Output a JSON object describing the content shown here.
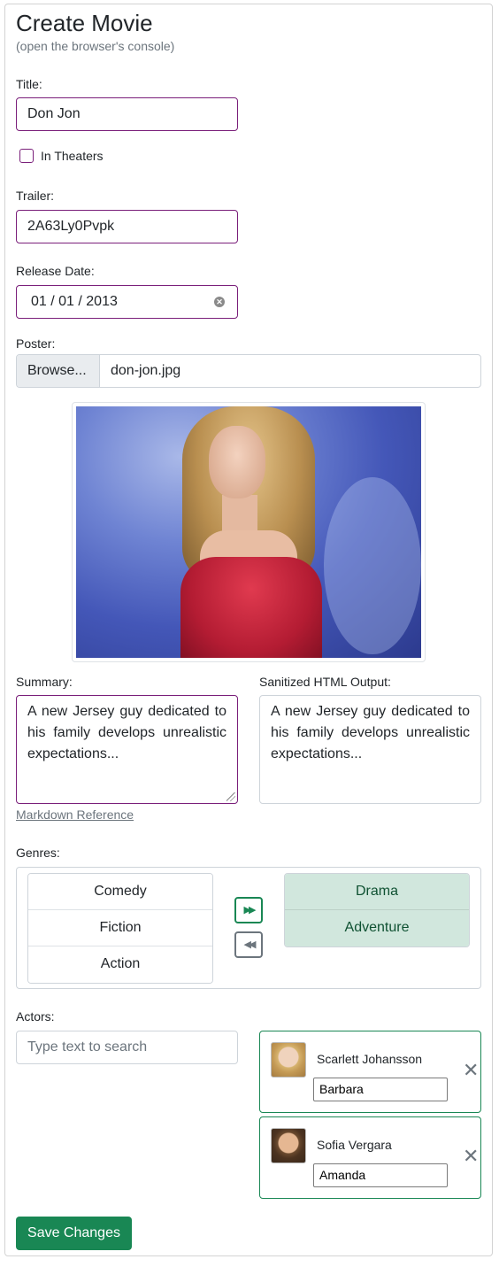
{
  "header": {
    "title": "Create Movie",
    "subtitle": "(open the browser's console)"
  },
  "form": {
    "title_label": "Title:",
    "title_value": "Don Jon",
    "in_theaters_label": "In Theaters",
    "in_theaters_checked": false,
    "trailer_label": "Trailer:",
    "trailer_value": "2A63Ly0Pvpk",
    "release_date_label": "Release Date:",
    "release_date_value": "01 / 01 / 2013",
    "poster_label": "Poster:",
    "browse_label": "Browse...",
    "poster_file": "don-jon.jpg",
    "summary_label": "Summary:",
    "summary_value": "A new Jersey guy dedicated to his family develops unrealistic expectations...",
    "sanitized_label": "Sanitized HTML Output:",
    "sanitized_value": "A new Jersey guy dedicated to his family develops unrealistic expectations...",
    "markdown_link": "Markdown Reference",
    "genres_label": "Genres:",
    "genres_available": [
      "Comedy",
      "Fiction",
      "Action"
    ],
    "genres_selected": [
      "Drama",
      "Adventure"
    ],
    "move_right_icon": "double-right-arrow-icon",
    "move_left_icon": "double-left-arrow-icon",
    "actors_label": "Actors:",
    "actor_search_placeholder": "Type text to search",
    "actors": [
      {
        "name": "Scarlett Johansson",
        "character": "Barbara"
      },
      {
        "name": "Sofia Vergara",
        "character": "Amanda"
      }
    ],
    "save_label": "Save Changes"
  },
  "colors": {
    "accent_border": "#7a1f7a",
    "success": "#198754",
    "selected_bg": "#d1e7dd",
    "muted": "#6c757d"
  }
}
